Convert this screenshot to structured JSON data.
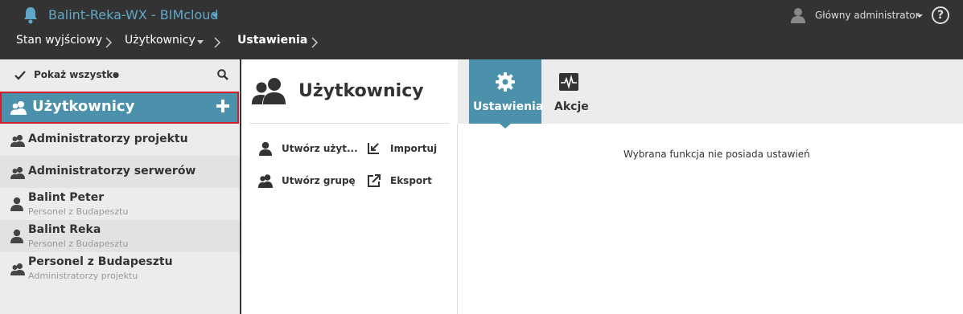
{
  "header": {
    "app_title": "Balint-Reka-WX - BIMcloud",
    "user_name": "Główny administrator",
    "help_glyph": "?",
    "icons": [
      "bell-icon",
      "user-icon",
      "help-icon"
    ]
  },
  "breadcrumb": {
    "items": [
      "Stan wyjściowy",
      "Użytkownicy",
      "Ustawienia"
    ]
  },
  "sidebar": {
    "show_all": "Pokaż wszystko",
    "section_title": "Użytkownicy",
    "items": [
      {
        "label": "Administratorzy projektu",
        "type": "group"
      },
      {
        "label": "Administratorzy serwerów",
        "type": "group"
      },
      {
        "label": "Balint Peter",
        "sub": "Personel z Budapesztu",
        "type": "user"
      },
      {
        "label": "Balint Reka",
        "sub": "Personel z Budapesztu",
        "type": "user"
      },
      {
        "label": "Personel z Budapesztu",
        "sub": "Administratorzy projektu",
        "type": "group"
      }
    ]
  },
  "middle": {
    "title": "Użytkownicy",
    "actions": [
      "Utwórz użyt...",
      "Importuj",
      "Utwórz grupę",
      "Eksport"
    ]
  },
  "tabs": [
    {
      "label": "Ustawienia",
      "icon": "gear-icon",
      "active": true
    },
    {
      "label": "Akcje",
      "icon": "activity-icon",
      "active": false
    }
  ],
  "content": {
    "message": "Wybrana funkcja nie posiada ustawień"
  },
  "colors": {
    "header_bg": "#333333",
    "accent": "#4c91ac",
    "title_blue": "#5fa8c9",
    "highlight_border": "#d0202e",
    "sidebar_bg": "#ececec"
  }
}
